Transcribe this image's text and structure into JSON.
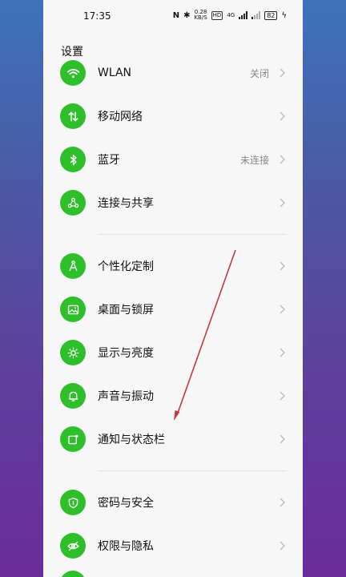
{
  "status_bar": {
    "time": "17:35",
    "net_speed_value": "0.28",
    "net_speed_unit": "KB/S",
    "hd_badge": "HD",
    "network_type": "4G",
    "battery_level": "82"
  },
  "page": {
    "title": "设置"
  },
  "groups": [
    {
      "items": [
        {
          "label": "WLAN",
          "value": "关闭",
          "icon": "wifi-icon"
        },
        {
          "label": "移动网络",
          "value": "",
          "icon": "mobile-data-icon"
        },
        {
          "label": "蓝牙",
          "value": "未连接",
          "icon": "bluetooth-icon"
        },
        {
          "label": "连接与共享",
          "value": "",
          "icon": "share-icon"
        }
      ]
    },
    {
      "items": [
        {
          "label": "个性化定制",
          "value": "",
          "icon": "compass-icon"
        },
        {
          "label": "桌面与锁屏",
          "value": "",
          "icon": "image-icon"
        },
        {
          "label": "显示与亮度",
          "value": "",
          "icon": "sun-icon"
        },
        {
          "label": "声音与振动",
          "value": "",
          "icon": "bell-icon"
        },
        {
          "label": "通知与状态栏",
          "value": "",
          "icon": "notification-icon"
        }
      ]
    },
    {
      "items": [
        {
          "label": "密码与安全",
          "value": "",
          "icon": "shield-icon"
        },
        {
          "label": "权限与隐私",
          "value": "",
          "icon": "privacy-eye-icon"
        }
      ]
    }
  ],
  "colors": {
    "icon_bg": "#2fbf2a",
    "annotation_arrow": "#c43a3a"
  }
}
